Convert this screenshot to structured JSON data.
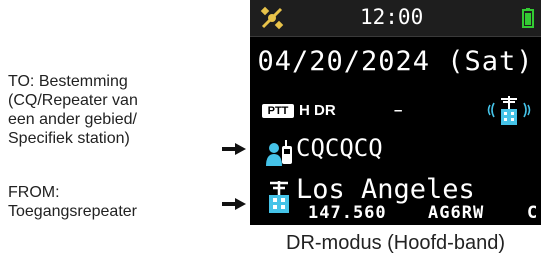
{
  "annotations": {
    "to_lines": [
      "TO: Bestemming",
      "(CQ/Repeater van",
      "een ander gebied/",
      "Specifiek station)"
    ],
    "from_lines": [
      "FROM:",
      "Toegangsrepeater"
    ]
  },
  "screen": {
    "clock": "12:00",
    "date": "04/20/2024 (Sat)",
    "ptt_badge": "PTT",
    "power": "H",
    "mode": "DR",
    "dash": "–",
    "to_call": "CQCQCQ",
    "from_name": "Los Angeles",
    "frequency": "147.560",
    "callsign": "AG6RW",
    "suffix": "C"
  },
  "caption": "DR-modus (Hoofd-band)",
  "colors": {
    "screen_bg": "#000000",
    "status_bar": "#1e1e1e",
    "accent_cyan": "#45c3e8",
    "battery_green": "#33cc33",
    "satellite_yellow": "#e8c34a"
  },
  "icons": [
    "satellite-icon",
    "battery-icon",
    "repeater-signal-icon",
    "person-radio-icon",
    "repeater-icon",
    "arrow-icon"
  ]
}
